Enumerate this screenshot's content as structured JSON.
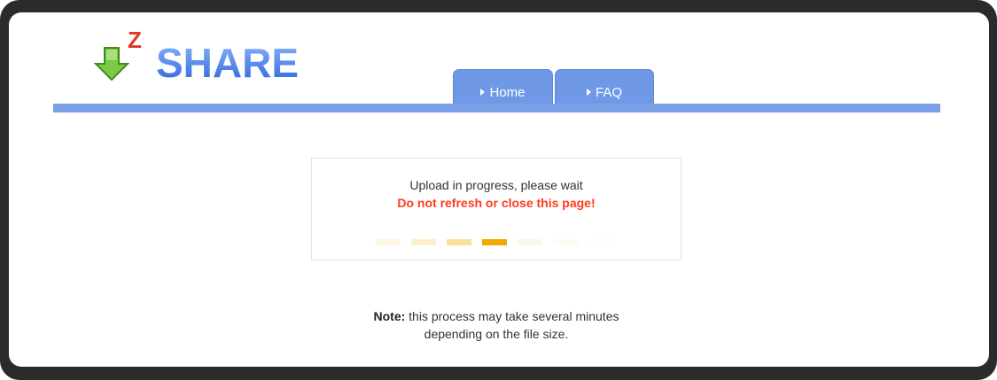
{
  "brand": {
    "logo_superscript": "Z",
    "logo_text": "SHARE",
    "logo_color": "#4a7fe0",
    "icon": "download-arrow-icon"
  },
  "nav": {
    "tabs": [
      {
        "label": "Home"
      },
      {
        "label": "FAQ"
      }
    ],
    "color": "#6f99e6"
  },
  "upload": {
    "status": "Upload in progress, please wait",
    "warning": "Do not refresh or close this page!",
    "warning_color": "#ff3b1f",
    "loader_colors": [
      "#fff7e6",
      "#fdf0c8",
      "#fbe09a",
      "#f2a800",
      "#fbf7ec",
      "#fdfbf2",
      "#fefdf8"
    ]
  },
  "note": {
    "label": "Note:",
    "text_line1": " this process may take several minutes",
    "text_line2": "depending on the file size."
  }
}
